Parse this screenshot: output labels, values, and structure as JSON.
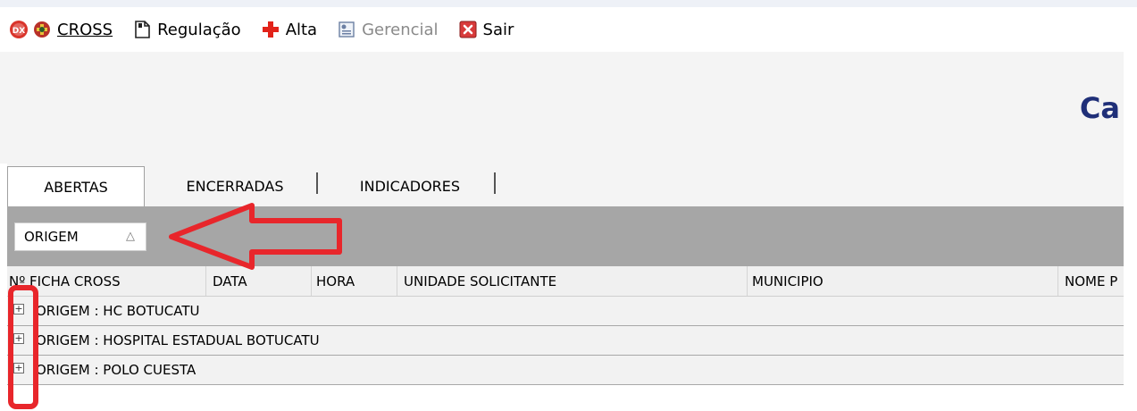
{
  "menu": {
    "items": [
      {
        "label": "CROSS",
        "icon": "cross-logo-icon",
        "disabled": false
      },
      {
        "label": "Regulação",
        "icon": "document-icon",
        "disabled": false
      },
      {
        "label": "Alta",
        "icon": "red-plus-icon",
        "disabled": false
      },
      {
        "label": "Gerencial",
        "icon": "report-icon",
        "disabled": true
      },
      {
        "label": "Sair",
        "icon": "exit-icon",
        "disabled": false
      }
    ]
  },
  "header": {
    "title_fragment": "Ca"
  },
  "tabs": [
    {
      "label": "ABERTAS",
      "active": true
    },
    {
      "label": "ENCERRADAS",
      "active": false
    },
    {
      "label": "INDICADORES",
      "active": false
    }
  ],
  "grouping": {
    "label": "ORIGEM",
    "sort_glyph": "△"
  },
  "columns": [
    "Nº FICHA CROSS",
    "DATA",
    "HORA",
    "UNIDADE SOLICITANTE",
    "MUNICIPIO",
    "NOME P"
  ],
  "groups": [
    {
      "label": "ORIGEM : HC BOTUCATU",
      "expander": "+"
    },
    {
      "label": "ORIGEM : HOSPITAL ESTADUAL BOTUCATU",
      "expander": "+"
    },
    {
      "label": "ORIGEM : POLO CUESTA",
      "expander": "+"
    }
  ],
  "colors": {
    "annotation_red": "#e8262b",
    "title_blue": "#1f2f78",
    "groupbar_gray": "#a6a6a6"
  }
}
